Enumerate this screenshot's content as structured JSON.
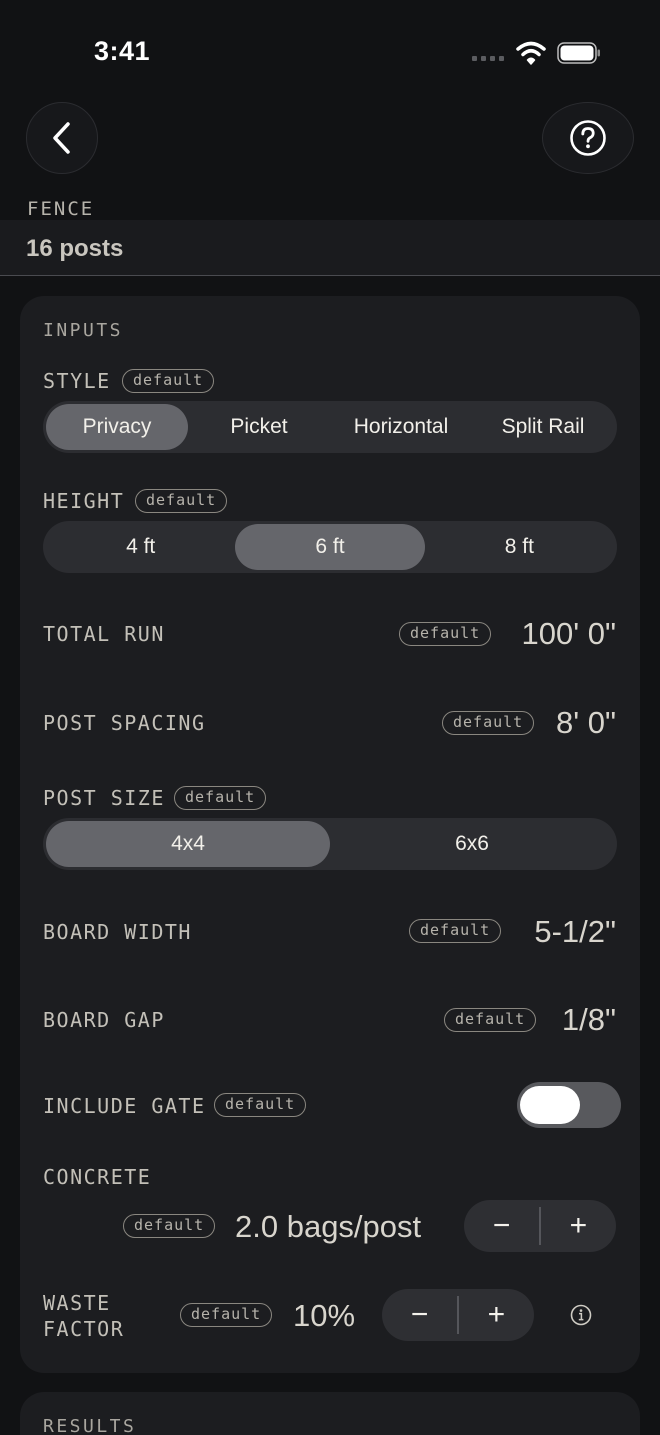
{
  "status": {
    "time": "3:41"
  },
  "header": {
    "section_label": "FENCE",
    "posts_summary": "16 posts"
  },
  "inputs": {
    "title": "INPUTS",
    "default_badge": "default",
    "style": {
      "label": "STYLE",
      "options": [
        "Privacy",
        "Picket",
        "Horizontal",
        "Split Rail"
      ],
      "selected": "Privacy"
    },
    "height": {
      "label": "HEIGHT",
      "options": [
        "4 ft",
        "6 ft",
        "8 ft"
      ],
      "selected": "6 ft"
    },
    "total_run": {
      "label": "TOTAL RUN",
      "value": "100' 0\""
    },
    "post_spacing": {
      "label": "POST SPACING",
      "value": "8' 0\""
    },
    "post_size": {
      "label": "POST SIZE",
      "options": [
        "4x4",
        "6x6"
      ],
      "selected": "4x4"
    },
    "board_width": {
      "label": "BOARD WIDTH",
      "value": "5-1/2\""
    },
    "board_gap": {
      "label": "BOARD GAP",
      "value": "1/8\""
    },
    "include_gate": {
      "label": "INCLUDE GATE",
      "on": true
    },
    "concrete": {
      "label": "CONCRETE",
      "value": "2.0 bags/post",
      "minus": "−",
      "plus": "+"
    },
    "waste_factor": {
      "label_line1": "WASTE",
      "label_line2": "FACTOR",
      "value": "10%",
      "minus": "−",
      "plus": "+"
    }
  },
  "results": {
    "title": "RESULTS"
  },
  "icons": {
    "back": "chevron-left-icon",
    "help": "question-circle-icon",
    "info": "info-circle-icon"
  }
}
